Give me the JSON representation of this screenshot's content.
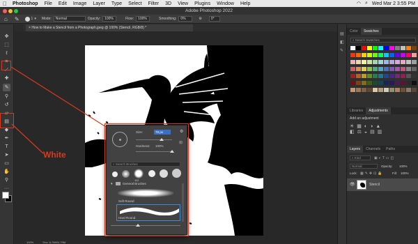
{
  "menubar": {
    "app": "Photoshop",
    "items": [
      "File",
      "Edit",
      "Image",
      "Layer",
      "Type",
      "Select",
      "Filter",
      "3D",
      "View",
      "Plugins",
      "Window",
      "Help"
    ],
    "clock": "Wed Mar 2  3:55 PM"
  },
  "window": {
    "title": "Adobe Photoshop 2022"
  },
  "options": {
    "mode_label": "Mode:",
    "mode_value": "Normal",
    "opacity_label": "Opacity:",
    "opacity_value": "100%",
    "flow_label": "Flow:",
    "flow_value": "100%",
    "smoothing_label": "Smoothing:",
    "smoothing_value": "0%",
    "angle_value": "0°",
    "brush_size": "1"
  },
  "document": {
    "tab_title": "How to Make a Stencil from a Photograph.jpeg @ 100% (Stencil, RGB/8) *"
  },
  "status": {
    "zoom": "100%",
    "doc": "Doc: 6.78M/4.79M"
  },
  "brush_picker": {
    "size_label": "Size:",
    "size_value": "78 px",
    "hardness_label": "Hardness:",
    "hardness_value": "100%",
    "search_placeholder": "Search Brushes",
    "preset_number": "112",
    "folder_label": "General Brushes",
    "soft_round": "Soft Round",
    "hard_round": "Hard Round"
  },
  "annotation": {
    "label": "White",
    "color": "#d93a1d"
  },
  "swatches_panel": {
    "tabs": [
      "Color",
      "Swatches"
    ],
    "search_placeholder": "Search Swatches"
  },
  "adjust_panel": {
    "tabs": [
      "Libraries",
      "Adjustments"
    ],
    "prompt": "Add an adjustment"
  },
  "layers_panel": {
    "tabs": [
      "Layers",
      "Channels",
      "Paths"
    ],
    "kind": "Kind",
    "blend": "Normal",
    "opacity_label": "Opacity:",
    "opacity_value": "100%",
    "lock_label": "Lock:",
    "fill_label": "Fill:",
    "fill_value": "100%",
    "layer_name": "Stencil"
  },
  "colors": {
    "foreground": "#ffffff",
    "accent": "#d93a1d"
  },
  "icons": [
    "apple-icon",
    "brush-icon",
    "move-icon",
    "marquee-icon",
    "lasso-icon",
    "crop-icon",
    "eyedropper-icon",
    "healing-icon",
    "stamp-icon",
    "history-brush-icon",
    "eraser-icon",
    "gradient-icon",
    "blur-icon",
    "dodge-icon",
    "pen-icon",
    "type-icon",
    "path-select-icon",
    "shape-icon",
    "hand-icon",
    "zoom-icon",
    "eye-icon",
    "gear-icon",
    "search-icon",
    "chevron-down-icon"
  ]
}
